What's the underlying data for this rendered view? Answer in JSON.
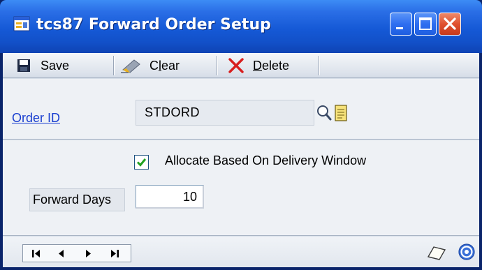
{
  "window": {
    "title": "tcs87 Forward Order Setup",
    "icons": {
      "app": "form-icon",
      "minimize": "minimize-icon",
      "maximize": "maximize-icon",
      "close": "close-icon"
    }
  },
  "toolbar": {
    "save_label": "Save",
    "clear_label": "Clear",
    "delete_label": "Delete",
    "icons": {
      "save": "floppy-disk-icon",
      "clear": "eraser-icon",
      "delete": "red-x-icon"
    }
  },
  "form": {
    "order_id_label": "Order ID",
    "order_id_value": "STDORD",
    "allocate_label": "Allocate Based On Delivery Window",
    "allocate_checked": true,
    "forward_days_label": "Forward Days",
    "forward_days_value": "10"
  },
  "navigation": {
    "first": "first-record-icon",
    "previous": "previous-record-icon",
    "next": "next-record-icon",
    "last": "last-record-icon"
  },
  "colors": {
    "title_bar": "#1559d6",
    "link": "#1a3fd0",
    "close_button": "#e0502e",
    "panel": "#eef1f5"
  }
}
